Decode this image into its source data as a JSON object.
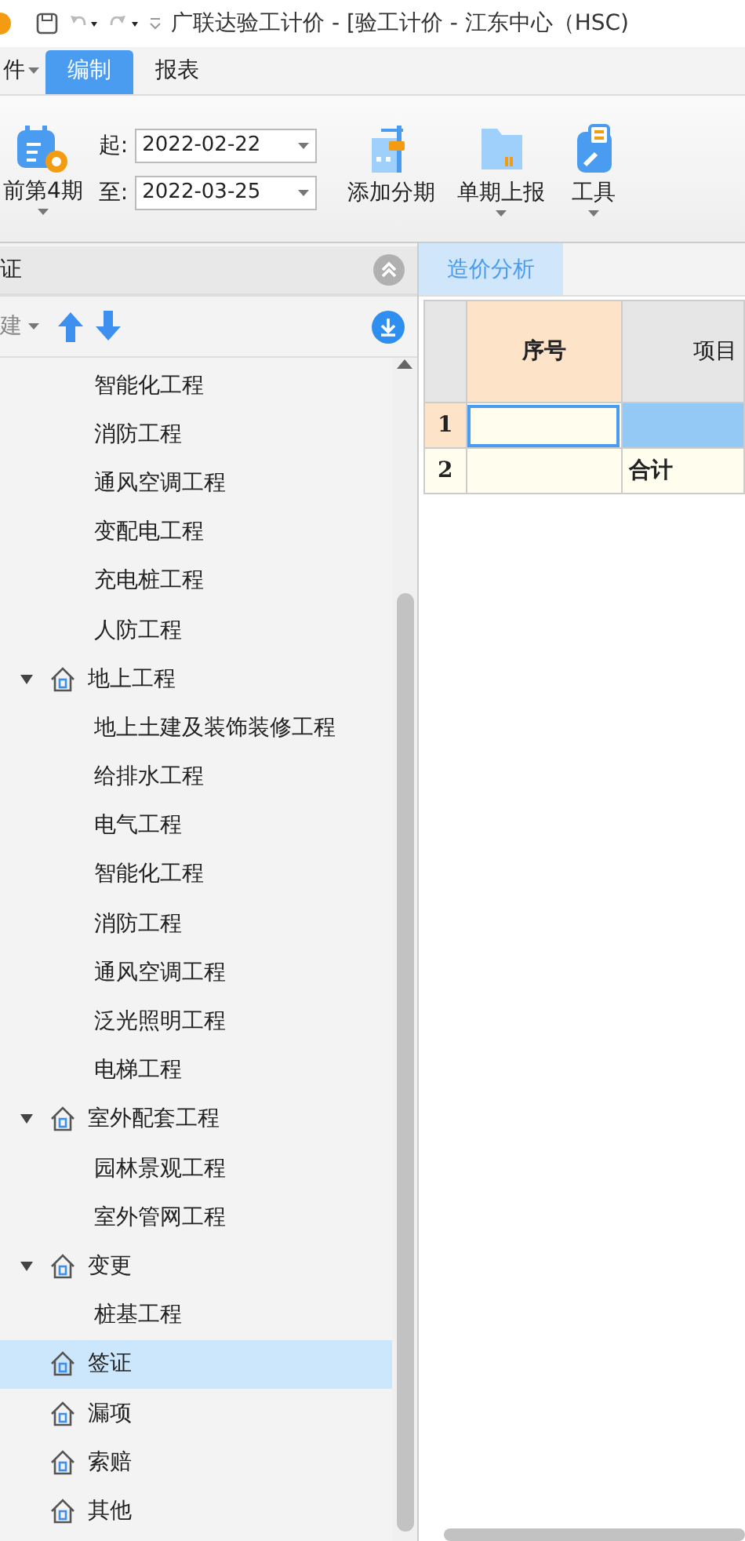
{
  "title_bar": {
    "title": "广联达验工计价 - [验工计价 - 江东中心（HSC)"
  },
  "menu_tabs": [
    {
      "label": "件",
      "kind": "menu",
      "selected": false
    },
    {
      "label": "编制",
      "kind": "tab",
      "selected": true
    },
    {
      "label": "报表",
      "kind": "tab",
      "selected": false
    }
  ],
  "ribbon": {
    "period_button": "前第4期",
    "start_label": "起:",
    "start_date": "2022-02-22",
    "end_label": "至:",
    "end_date": "2022-03-25",
    "buttons": [
      {
        "label": "添加分期",
        "kind": "building",
        "dropdown": false
      },
      {
        "label": "单期上报",
        "kind": "folder",
        "dropdown": true
      },
      {
        "label": "工具",
        "kind": "tools",
        "dropdown": true
      }
    ]
  },
  "left_panel": {
    "title": "证",
    "new_button": "建",
    "tree": {
      "continued_children": [
        {
          "label": "智能化工程"
        },
        {
          "label": "消防工程"
        },
        {
          "label": "通风空调工程"
        },
        {
          "label": "变配电工程"
        },
        {
          "label": "充电桩工程"
        },
        {
          "label": "人防工程"
        }
      ],
      "items": [
        {
          "label": "地上工程",
          "expanded": true,
          "selected": false,
          "children": [
            {
              "label": "地上土建及装饰装修工程"
            },
            {
              "label": "给排水工程"
            },
            {
              "label": "电气工程"
            },
            {
              "label": "智能化工程"
            },
            {
              "label": "消防工程"
            },
            {
              "label": "通风空调工程"
            },
            {
              "label": "泛光照明工程"
            },
            {
              "label": "电梯工程"
            }
          ]
        },
        {
          "label": "室外配套工程",
          "expanded": true,
          "selected": false,
          "children": [
            {
              "label": "园林景观工程"
            },
            {
              "label": "室外管网工程"
            }
          ]
        },
        {
          "label": "变更",
          "expanded": true,
          "selected": false,
          "children": [
            {
              "label": "桩基工程"
            }
          ]
        },
        {
          "label": "签证",
          "selected": true
        },
        {
          "label": "漏项",
          "selected": false
        },
        {
          "label": "索赔",
          "selected": false
        },
        {
          "label": "其他",
          "selected": false
        }
      ]
    }
  },
  "content_tabs": [
    {
      "label": "造价分析",
      "selected": true
    }
  ],
  "table": {
    "columns": [
      "序号",
      "项目"
    ],
    "rows": [
      {
        "number": "1",
        "selected": true,
        "cells": [
          "",
          ""
        ]
      },
      {
        "number": "2",
        "selected": false,
        "cells": [
          "",
          "合计"
        ]
      }
    ]
  }
}
